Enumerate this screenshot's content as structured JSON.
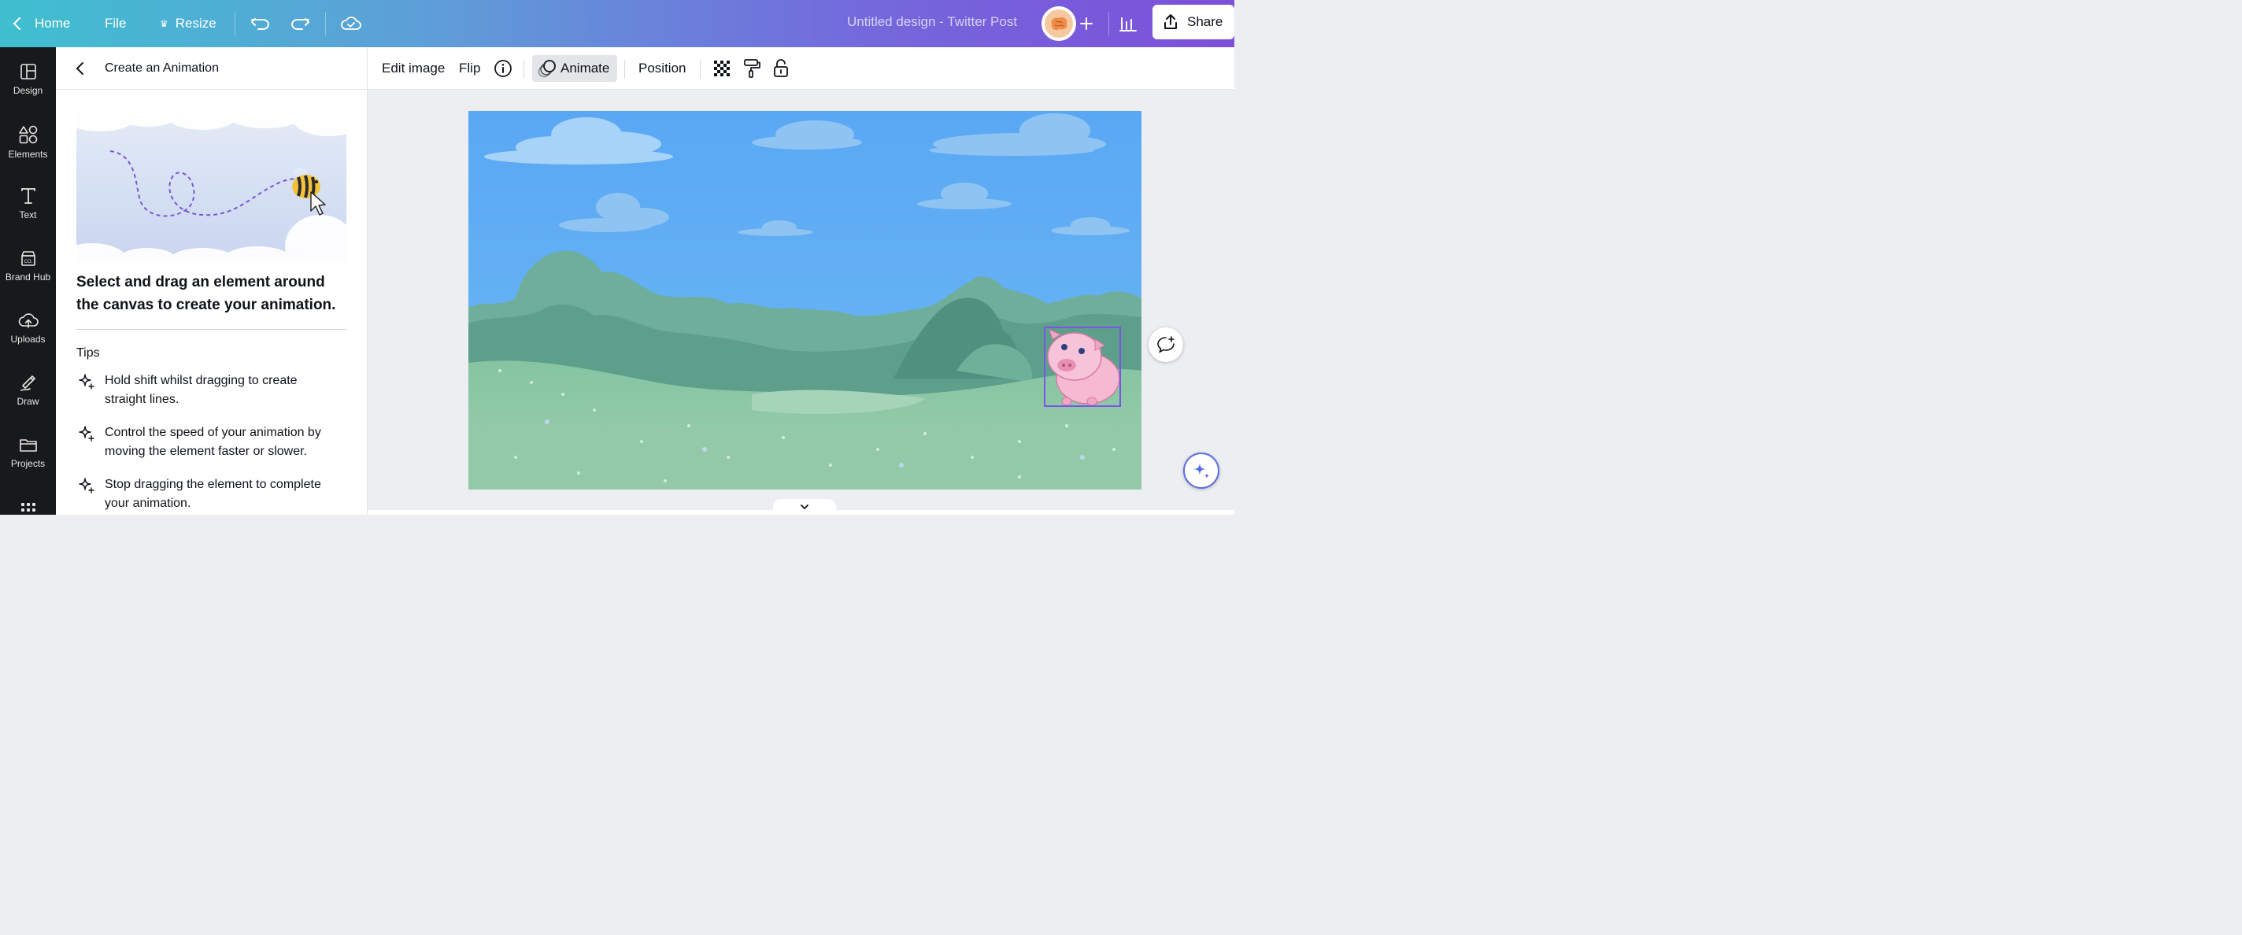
{
  "topbar": {
    "home_label": "Home",
    "file_label": "File",
    "resize_label": "Resize",
    "document_title": "Untitled design - Twitter Post",
    "share_label": "Share"
  },
  "rail": {
    "items": [
      {
        "label": "Design",
        "icon": "layout-icon"
      },
      {
        "label": "Elements",
        "icon": "shapes-icon"
      },
      {
        "label": "Text",
        "icon": "text-icon"
      },
      {
        "label": "Brand Hub",
        "icon": "brand-icon"
      },
      {
        "label": "Uploads",
        "icon": "cloud-upload-icon"
      },
      {
        "label": "Draw",
        "icon": "pen-icon"
      },
      {
        "label": "Projects",
        "icon": "folder-icon"
      }
    ]
  },
  "panel": {
    "title": "Create an Animation",
    "instruction": "Select and drag an element around the canvas to create your animation.",
    "tips_label": "Tips",
    "tips": [
      "Hold shift whilst dragging to create straight lines.",
      "Control the speed of your animation by moving the element faster or slower.",
      "Stop dragging the element to complete your animation."
    ]
  },
  "toolbar": {
    "edit_image_label": "Edit image",
    "flip_label": "Flip",
    "animate_label": "Animate",
    "position_label": "Position"
  },
  "colors": {
    "accent": "#7a55e6",
    "sky": "#5daef5",
    "rail_bg": "#18191b"
  }
}
